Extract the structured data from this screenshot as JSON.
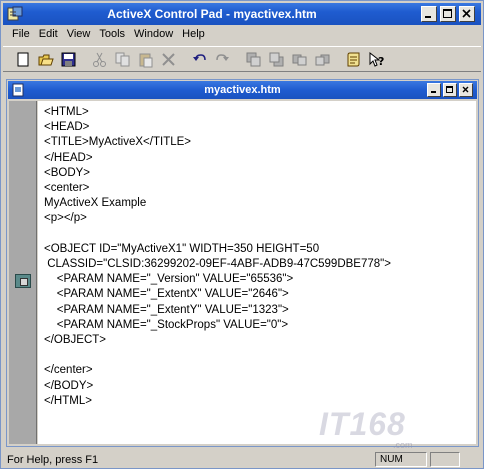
{
  "app": {
    "title": "ActiveX Control Pad - myactivex.htm"
  },
  "menu": [
    "File",
    "Edit",
    "View",
    "Tools",
    "Window",
    "Help"
  ],
  "toolbar": [
    {
      "name": "new-icon"
    },
    {
      "name": "open-folder-icon"
    },
    {
      "name": "save-icon"
    },
    {
      "sep": true
    },
    {
      "name": "cut-icon",
      "disabled": true
    },
    {
      "name": "copy-icon",
      "disabled": true
    },
    {
      "name": "paste-icon",
      "disabled": true
    },
    {
      "name": "delete-icon",
      "disabled": true
    },
    {
      "sep": true
    },
    {
      "name": "undo-icon"
    },
    {
      "name": "redo-icon",
      "disabled": true
    },
    {
      "sep": true
    },
    {
      "name": "bring-to-front-icon",
      "disabled": true
    },
    {
      "name": "send-to-back-icon",
      "disabled": true
    },
    {
      "name": "bring-forward-icon",
      "disabled": true
    },
    {
      "name": "send-backward-icon",
      "disabled": true
    },
    {
      "sep": true
    },
    {
      "name": "script-wizard-icon"
    },
    {
      "name": "context-help-icon"
    }
  ],
  "document": {
    "title": "myactivex.htm",
    "lines": [
      "<HTML>",
      "<HEAD>",
      "<TITLE>MyActiveX</TITLE>",
      "</HEAD>",
      "<BODY>",
      "<center>",
      "MyActiveX Example",
      "<p></p>",
      "",
      "<OBJECT ID=\"MyActiveX1\" WIDTH=350 HEIGHT=50",
      " CLASSID=\"CLSID:36299202-09EF-4ABF-ADB9-47C599DBE778\">",
      "    <PARAM NAME=\"_Version\" VALUE=\"65536\">",
      "    <PARAM NAME=\"_ExtentX\" VALUE=\"2646\">",
      "    <PARAM NAME=\"_ExtentY\" VALUE=\"1323\">",
      "    <PARAM NAME=\"_StockProps\" VALUE=\"0\">",
      "</OBJECT>",
      "",
      "</center>",
      "</BODY>",
      "</HTML>"
    ]
  },
  "status": {
    "help": "For Help, press F1",
    "num": "NUM"
  },
  "watermark": {
    "text": "IT168",
    "sub": ".com"
  }
}
